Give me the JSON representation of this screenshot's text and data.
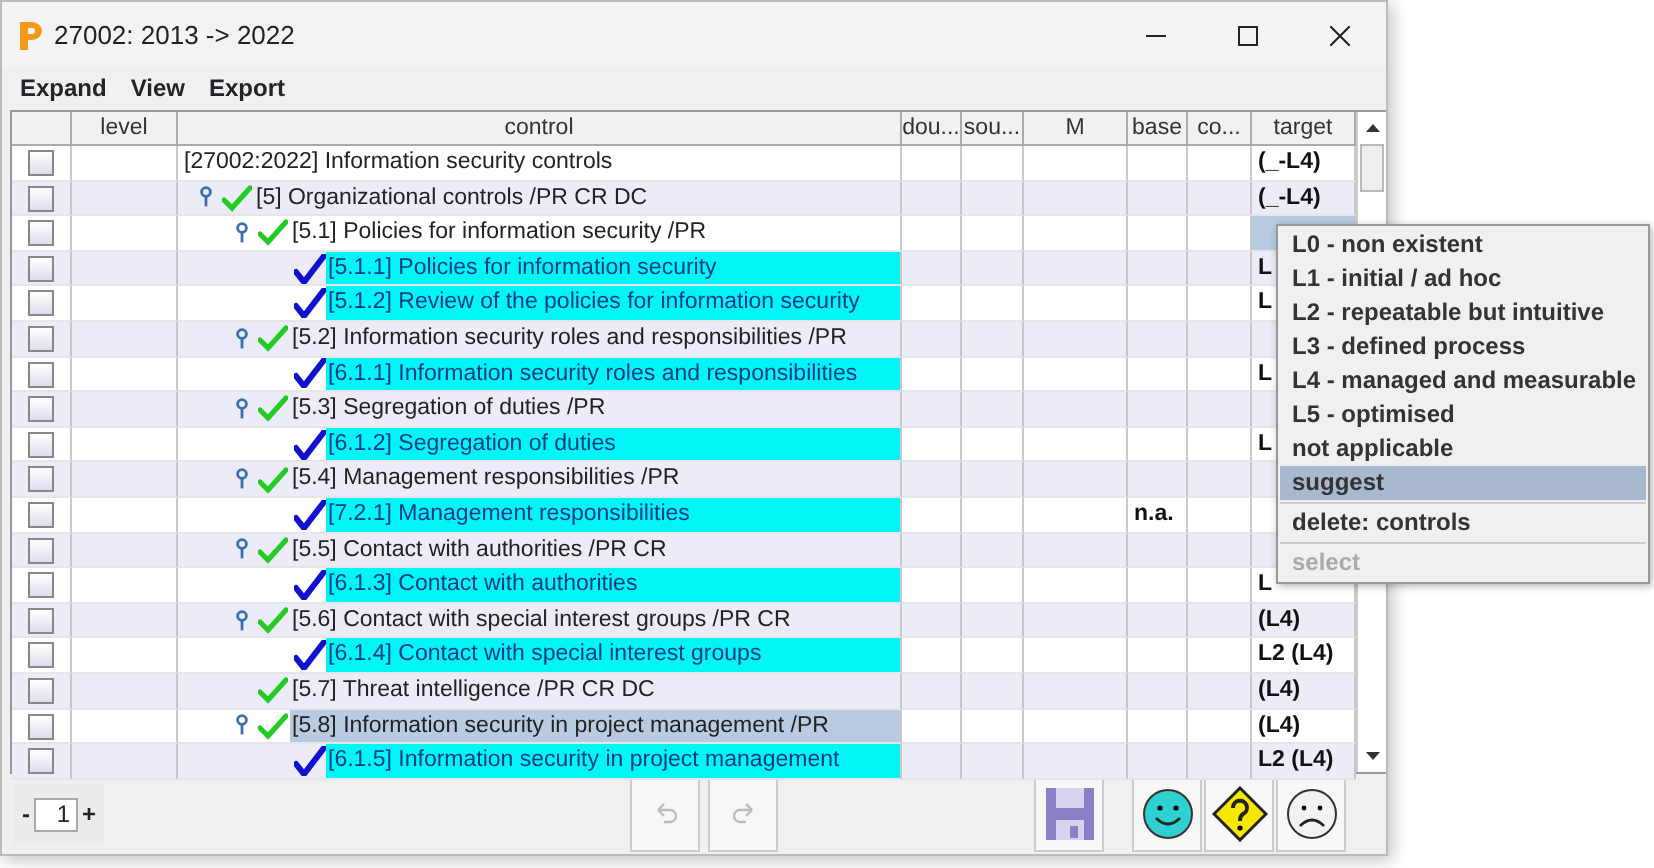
{
  "window": {
    "title": "27002: 2013 -> 2022"
  },
  "menu_bar": [
    "Expand",
    "View",
    "Export"
  ],
  "table": {
    "columns": [
      "level",
      "control",
      "dou...",
      "sou...",
      "M",
      "base",
      "co...",
      "target"
    ],
    "rows": [
      {
        "label": "[27002:2022] Information security controls",
        "kind": "root",
        "checked": false,
        "selected": false,
        "target_selected": false,
        "target": "(_-L4)",
        "children": [
          {
            "label": "[5] Organizational controls /PR CR DC",
            "kind": "group",
            "checked": false,
            "selected": false,
            "target_selected": false,
            "target": "(_-L4)",
            "children": [
              {
                "label": "[5.1] Policies for information security /PR",
                "kind": "group",
                "checked": false,
                "selected": false,
                "target_selected": true,
                "children": [
                  {
                    "label": "[5.1.1] Policies for information security",
                    "kind": "leaf",
                    "checked": false,
                    "selected": false,
                    "target_selected": false,
                    "target": "L"
                  },
                  {
                    "label": "[5.1.2] Review of the policies for information security",
                    "kind": "leaf",
                    "checked": false,
                    "selected": false,
                    "target_selected": false,
                    "target": "L"
                  }
                ]
              },
              {
                "label": "[5.2] Information security roles and responsibilities /PR",
                "kind": "group",
                "checked": false,
                "selected": false,
                "target_selected": false,
                "children": [
                  {
                    "label": "[6.1.1] Information security roles and responsibilities",
                    "kind": "leaf",
                    "checked": false,
                    "selected": false,
                    "target_selected": false,
                    "target": "L"
                  }
                ]
              },
              {
                "label": "[5.3] Segregation of duties /PR",
                "kind": "group",
                "checked": false,
                "selected": false,
                "target_selected": false,
                "children": [
                  {
                    "label": "[6.1.2] Segregation of duties",
                    "kind": "leaf",
                    "checked": false,
                    "selected": false,
                    "target_selected": false,
                    "target": "L"
                  }
                ]
              },
              {
                "label": "[5.4] Management responsibilities /PR",
                "kind": "group",
                "checked": false,
                "selected": false,
                "target_selected": false,
                "children": [
                  {
                    "label": "[7.2.1] Management responsibilities",
                    "kind": "leaf",
                    "checked": false,
                    "selected": false,
                    "target_selected": false,
                    "base": "n.a."
                  }
                ]
              },
              {
                "label": "[5.5] Contact with authorities /PR CR",
                "kind": "group",
                "checked": false,
                "selected": false,
                "target_selected": false,
                "children": [
                  {
                    "label": "[6.1.3] Contact with authorities",
                    "kind": "leaf",
                    "checked": false,
                    "selected": false,
                    "target_selected": false,
                    "target": "L"
                  }
                ]
              },
              {
                "label": "[5.6] Contact with special interest groups /PR CR",
                "kind": "group",
                "checked": false,
                "selected": false,
                "target_selected": false,
                "target": "(L4)",
                "children": [
                  {
                    "label": "[6.1.4] Contact with special interest groups",
                    "kind": "leaf",
                    "checked": false,
                    "selected": false,
                    "target_selected": false,
                    "target": "L2 (L4)"
                  }
                ]
              },
              {
                "label": "[5.7] Threat intelligence /PR CR DC",
                "kind": "group",
                "checked": false,
                "selected": false,
                "target_selected": false,
                "target": "(L4)"
              },
              {
                "label": "[5.8] Information security in project management /PR",
                "kind": "group",
                "checked": false,
                "selected": true,
                "target_selected": false,
                "target": "(L4)",
                "children": [
                  {
                    "label": "[6.1.5] Information security in project management",
                    "kind": "leaf",
                    "checked": false,
                    "selected": false,
                    "target_selected": false,
                    "target": "L2 (L4)"
                  }
                ]
              }
            ]
          }
        ]
      }
    ]
  },
  "context_menu": [
    {
      "kind": "item",
      "label": "L0 - non existent",
      "selected": false,
      "disabled": false
    },
    {
      "kind": "item",
      "label": "L1 - initial / ad hoc",
      "selected": false,
      "disabled": false
    },
    {
      "kind": "item",
      "label": "L2 - repeatable but intuitive",
      "selected": false,
      "disabled": false
    },
    {
      "kind": "item",
      "label": "L3 - defined process",
      "selected": false,
      "disabled": false
    },
    {
      "kind": "item",
      "label": "L4 - managed and measurable",
      "selected": false,
      "disabled": false
    },
    {
      "kind": "item",
      "label": "L5 - optimised",
      "selected": false,
      "disabled": false
    },
    {
      "kind": "item",
      "label": "not applicable",
      "selected": false,
      "disabled": false
    },
    {
      "kind": "item",
      "label": "suggest",
      "selected": true,
      "disabled": false
    },
    {
      "kind": "separator"
    },
    {
      "kind": "item",
      "label": "delete: controls",
      "selected": false,
      "disabled": false
    },
    {
      "kind": "separator"
    },
    {
      "kind": "item",
      "label": "select",
      "selected": false,
      "disabled": true
    }
  ],
  "footer": {
    "minus": "-",
    "page": "1",
    "plus": "+"
  }
}
